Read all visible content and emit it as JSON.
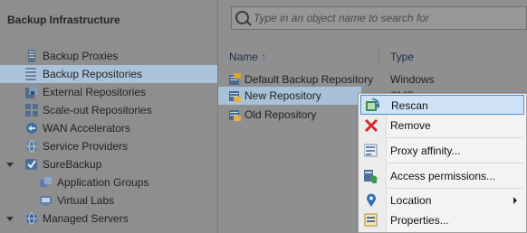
{
  "left_panel": {
    "title": "Backup Infrastructure",
    "items": [
      {
        "label": "Backup Proxies",
        "icon": "proxy-icon"
      },
      {
        "label": "Backup Repositories",
        "icon": "repository-icon",
        "selected": true
      },
      {
        "label": "External Repositories",
        "icon": "external-repository-icon"
      },
      {
        "label": "Scale-out Repositories",
        "icon": "scaleout-repository-icon"
      },
      {
        "label": "WAN Accelerators",
        "icon": "wan-accelerator-icon"
      },
      {
        "label": "Service Providers",
        "icon": "service-provider-icon"
      },
      {
        "label": "SureBackup",
        "icon": "surebackup-icon",
        "expanded": true
      },
      {
        "label": "Application Groups",
        "icon": "application-group-icon"
      },
      {
        "label": "Virtual Labs",
        "icon": "virtual-lab-icon"
      },
      {
        "label": "Managed Servers",
        "icon": "managed-servers-icon",
        "expanded": true
      }
    ]
  },
  "search": {
    "placeholder": "Type in an object name to search for",
    "value": ""
  },
  "table": {
    "headers": {
      "name": "Name",
      "name_sort": "↑",
      "type": "Type"
    },
    "rows": [
      {
        "name": "Default Backup Repository",
        "type": "Windows"
      },
      {
        "name": "New Repository",
        "type": "SMB",
        "selected": true
      },
      {
        "name": "Old Repository",
        "type": ""
      }
    ]
  },
  "context_menu": {
    "items": [
      {
        "label": "Rescan",
        "icon": "rescan-icon"
      },
      {
        "label": "Remove",
        "icon": "remove-icon"
      },
      {
        "label": "Proxy affinity...",
        "icon": "proxy-affinity-icon"
      },
      {
        "label": "Access permissions...",
        "icon": "access-permissions-icon"
      },
      {
        "label": "Location",
        "icon": "location-icon",
        "submenu": true
      },
      {
        "label": "Properties...",
        "icon": "properties-icon"
      }
    ]
  },
  "colors": {
    "selection": "#aac3da",
    "menu_highlight": "#cfe2f7",
    "menu_highlight_border": "#4a8fd6",
    "remove_red": "#d9262b"
  }
}
